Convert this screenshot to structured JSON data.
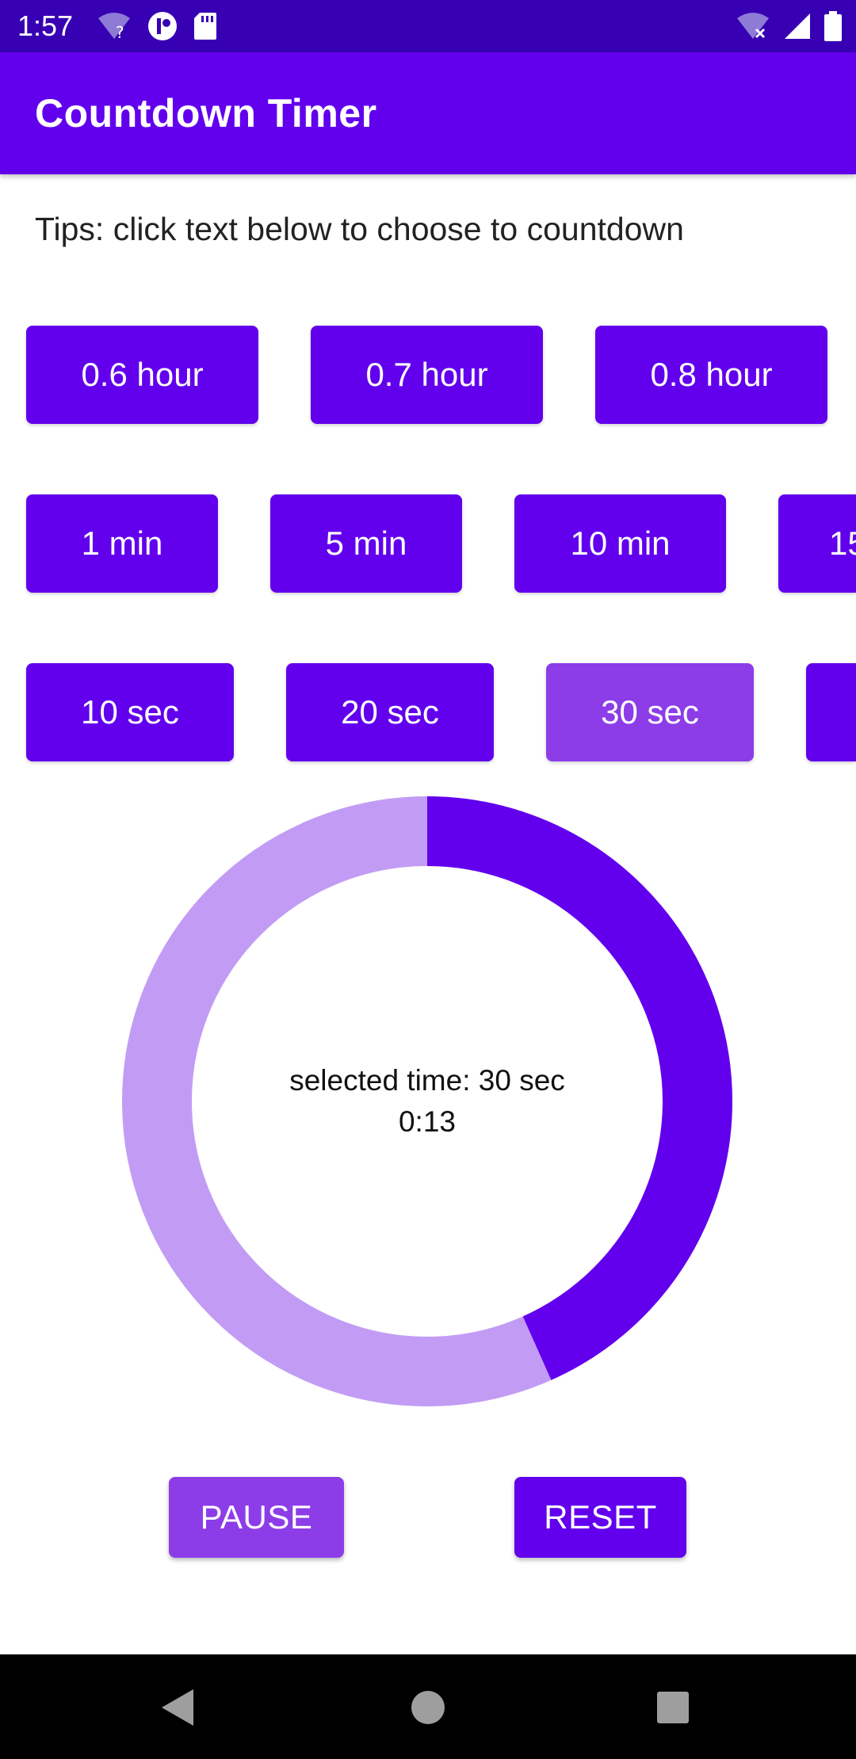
{
  "status_bar": {
    "time": "1:57",
    "icons_left": [
      "wifi-question-icon",
      "tide-app-icon",
      "sd-card-icon"
    ],
    "icons_right": [
      "wifi-off-icon",
      "cellular-signal-icon",
      "battery-icon"
    ],
    "background": "#3700b3"
  },
  "app_bar": {
    "title": "Countdown Timer",
    "background": "#6200ee"
  },
  "tips": "Tips: click text below to choose to countdown",
  "hour_options": [
    "0.6 hour",
    "0.7 hour",
    "0.8 hour"
  ],
  "minute_options": [
    "1 min",
    "5 min",
    "10 min",
    "15"
  ],
  "second_options": [
    "10 sec",
    "20 sec",
    "30 sec",
    ""
  ],
  "selected_option": "30 sec",
  "timer": {
    "selected_label": "selected time: 30 sec",
    "remaining": "0:13",
    "total_seconds": 30,
    "remaining_seconds": 13,
    "progress_color": "#6200ee",
    "track_color": "#c29cf4"
  },
  "controls": {
    "pause_label": "PAUSE",
    "reset_label": "RESET",
    "pause_color": "#8c3de8",
    "reset_color": "#6200ee"
  },
  "nav_bar": {
    "icons": [
      "back-icon",
      "home-icon",
      "recents-icon"
    ]
  }
}
